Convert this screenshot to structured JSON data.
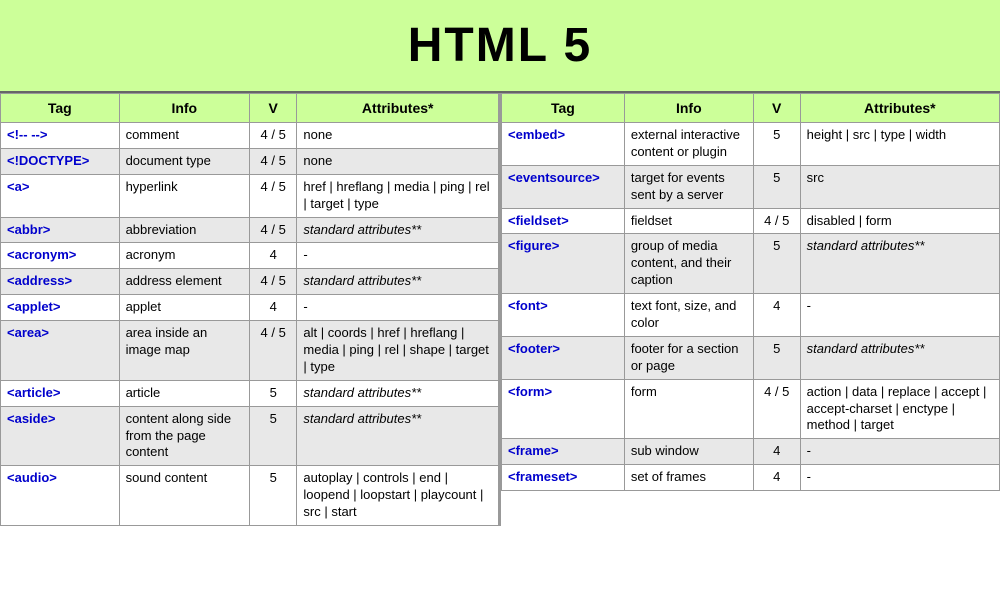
{
  "header": {
    "title": "HTML 5"
  },
  "left_table": {
    "columns": [
      "Tag",
      "Info",
      "V",
      "Attributes*"
    ],
    "rows": [
      {
        "tag": "<!-- -->",
        "info": "comment",
        "v": "4 / 5",
        "attr": "none",
        "italic": false
      },
      {
        "tag": "<!DOCTYPE>",
        "info": "document type",
        "v": "4 / 5",
        "attr": "none",
        "italic": false
      },
      {
        "tag": "<a>",
        "info": "hyperlink",
        "v": "4 / 5",
        "attr": "href | hreflang | media | ping | rel | target | type",
        "italic": false
      },
      {
        "tag": "<abbr>",
        "info": "abbreviation",
        "v": "4 / 5",
        "attr": "standard attributes**",
        "italic": true
      },
      {
        "tag": "<acronym>",
        "info": "acronym",
        "v": "4",
        "attr": "-",
        "italic": false
      },
      {
        "tag": "<address>",
        "info": "address element",
        "v": "4 / 5",
        "attr": "standard attributes**",
        "italic": true
      },
      {
        "tag": "<applet>",
        "info": "applet",
        "v": "4",
        "attr": "-",
        "italic": false
      },
      {
        "tag": "<area>",
        "info": "area inside an image map",
        "v": "4 / 5",
        "attr": "alt | coords | href | hreflang | media | ping | rel | shape | target | type",
        "italic": false
      },
      {
        "tag": "<article>",
        "info": "article",
        "v": "5",
        "attr": "standard attributes**",
        "italic": true
      },
      {
        "tag": "<aside>",
        "info": "content along side from the page content",
        "v": "5",
        "attr": "standard attributes**",
        "italic": true
      },
      {
        "tag": "<audio>",
        "info": "sound content",
        "v": "5",
        "attr": "autoplay | controls | end | loopend | loopstart | playcount | src | start",
        "italic": false
      }
    ]
  },
  "right_table": {
    "columns": [
      "Tag",
      "Info",
      "V",
      "Attributes*"
    ],
    "rows": [
      {
        "tag": "<embed>",
        "info": "external interactive content or plugin",
        "v": "5",
        "attr": "height | src | type | width",
        "italic": false
      },
      {
        "tag": "<eventsource>",
        "info": "target for events sent by a server",
        "v": "5",
        "attr": "src",
        "italic": false
      },
      {
        "tag": "<fieldset>",
        "info": "fieldset",
        "v": "4 / 5",
        "attr": "disabled | form",
        "italic": false
      },
      {
        "tag": "<figure>",
        "info": "group of media content, and their caption",
        "v": "5",
        "attr": "standard attributes**",
        "italic": true
      },
      {
        "tag": "<font>",
        "info": "text font, size, and color",
        "v": "4",
        "attr": "-",
        "italic": false
      },
      {
        "tag": "<footer>",
        "info": "footer for a section or page",
        "v": "5",
        "attr": "standard attributes**",
        "italic": true
      },
      {
        "tag": "<form>",
        "info": "form",
        "v": "4 / 5",
        "attr": "action | data | replace | accept | accept-charset | enctype | method | target",
        "italic": false
      },
      {
        "tag": "<frame>",
        "info": "sub window",
        "v": "4",
        "attr": "-",
        "italic": false
      },
      {
        "tag": "<frameset>",
        "info": "set of frames",
        "v": "4",
        "attr": "-",
        "italic": false
      }
    ]
  }
}
